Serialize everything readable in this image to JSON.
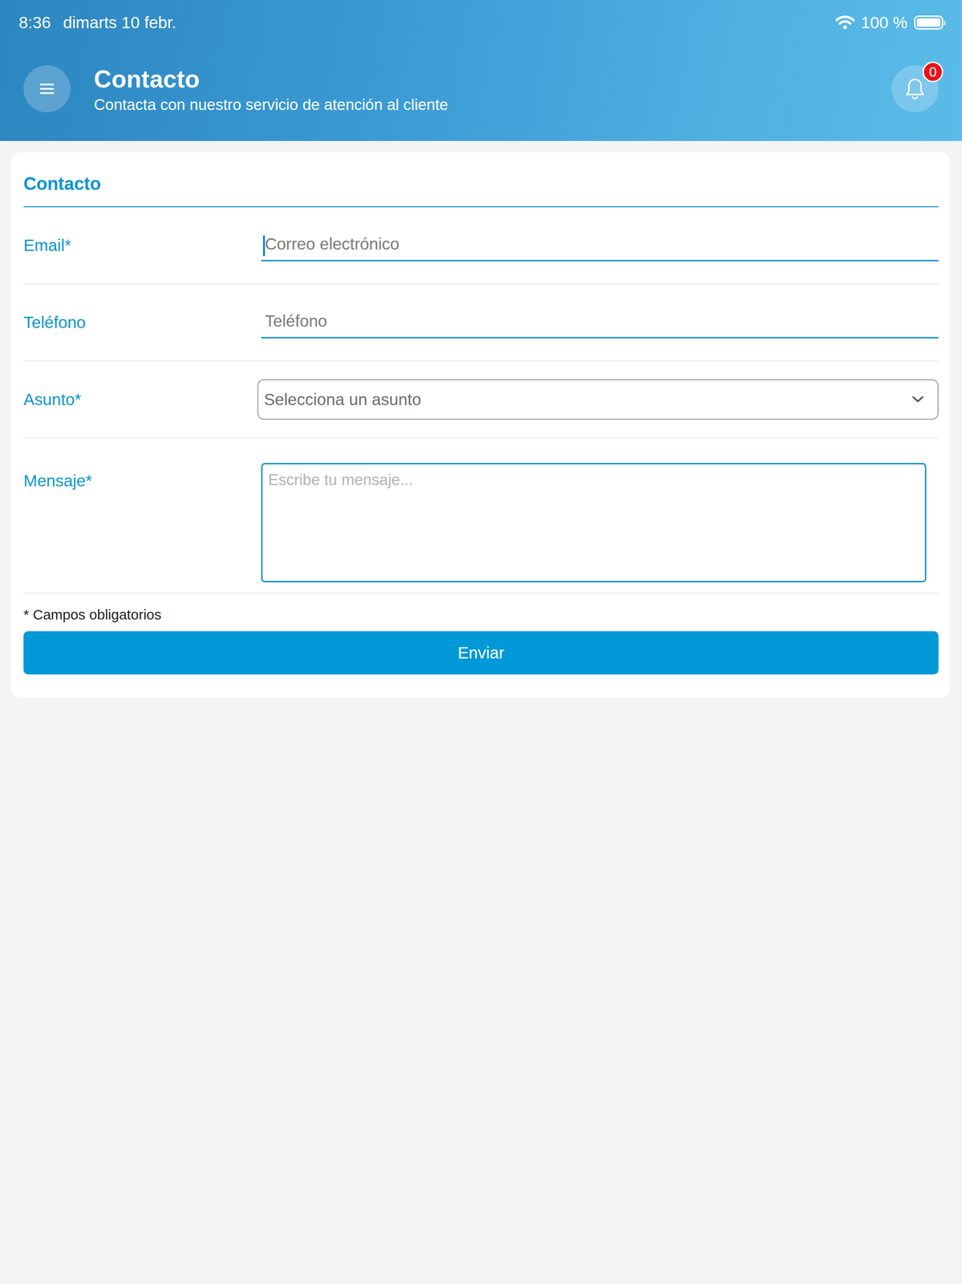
{
  "status_bar": {
    "time": "8:36",
    "date": "dimarts 10 febr.",
    "battery": "100 %",
    "battery_level": 1.0
  },
  "header": {
    "title": "Contacto",
    "subtitle": "Contacta con nuestro servicio de atención al cliente",
    "notifications": "0"
  },
  "form": {
    "title": "Contacto",
    "fields": [
      {
        "kind": "input",
        "label": "Email*",
        "placeholder": "Correo electrónico",
        "focused": true
      },
      {
        "kind": "input",
        "label": "Teléfono",
        "placeholder": "Teléfono",
        "focused": false
      },
      {
        "kind": "select",
        "label": "Asunto*",
        "placeholder": "Selecciona un asunto",
        "focused": false
      },
      {
        "kind": "textarea",
        "label": "Mensaje*",
        "placeholder": "Escribe tu mensaje...",
        "focused": false
      }
    ],
    "required_note": "* Campos obligatorios",
    "submit": "Enviar"
  }
}
